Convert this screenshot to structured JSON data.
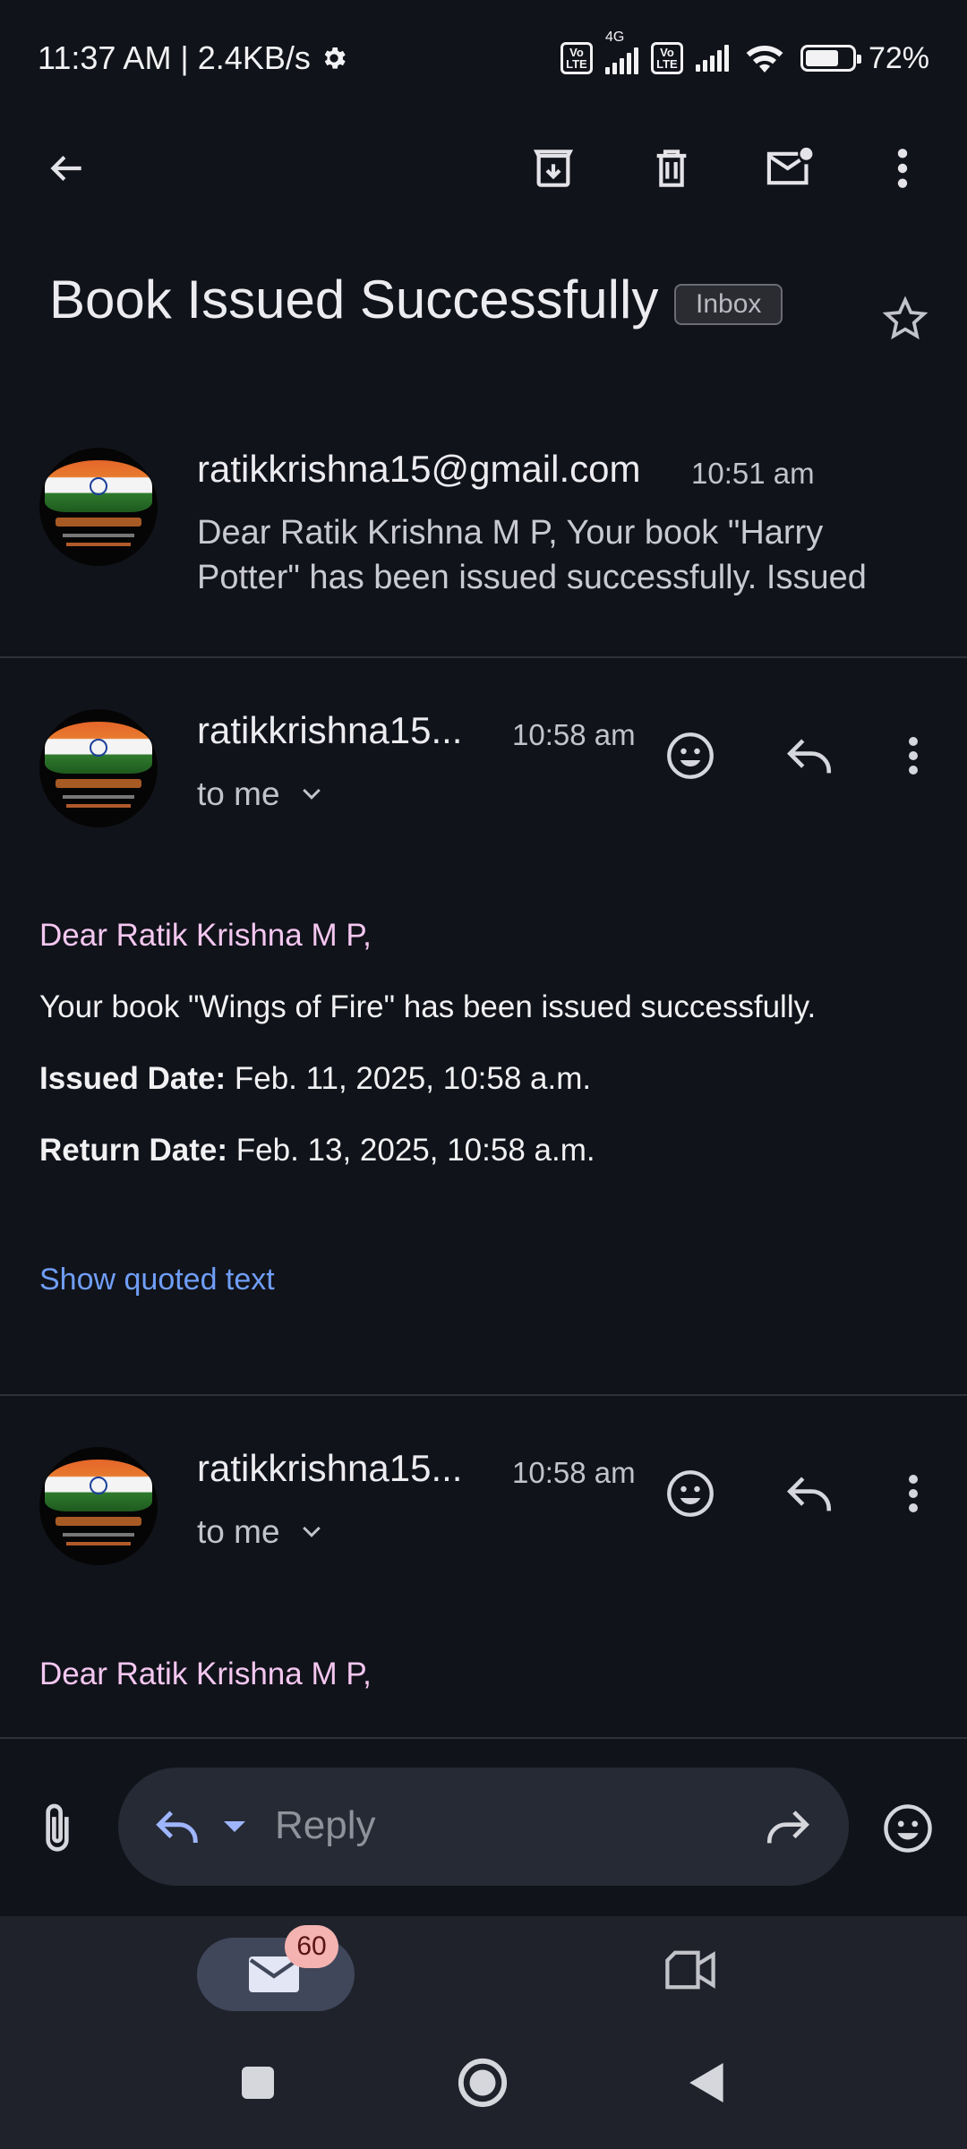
{
  "status_bar": {
    "time": "11:37 AM | 2.4KB/s",
    "network_type": "4G",
    "volte_label": "Vo LTE",
    "battery": "72%",
    "battery_level": 0.72
  },
  "toolbar": {
    "back_icon": "arrow-back-icon",
    "archive_icon": "archive-icon",
    "delete_icon": "trash-icon",
    "mark_unread_icon": "mark-unread-icon",
    "more_icon": "more-vert-icon"
  },
  "thread": {
    "subject": "Book Issued Successfully",
    "label": "Inbox"
  },
  "messages": [
    {
      "sender": "ratikkrishna15@gmail.com",
      "time": "10:51 am",
      "snippet": "Dear Ratik Krishna M P, Your book \"Harry Potter\" has been issued successfully. Issued"
    },
    {
      "sender": "ratikkrishna15...",
      "time": "10:58 am",
      "recipient": "to me",
      "greeting": "Dear Ratik Krishna M P,",
      "body": "Your book \"Wings of Fire\" has been issued successfully.",
      "issued_label": "Issued Date:",
      "issued_value": " Feb. 11, 2025, 10:58 a.m.",
      "return_label": "Return Date:",
      "return_value": " Feb. 13, 2025, 10:58 a.m.",
      "quoted_link": "Show quoted text"
    },
    {
      "sender": "ratikkrishna15...",
      "time": "10:58 am",
      "recipient": "to me",
      "greeting": "Dear Ratik Krishna M P,"
    }
  ],
  "reply_bar": {
    "placeholder": "Reply"
  },
  "bottom_nav": {
    "mail_badge": "60"
  },
  "colors": {
    "background": "#11131a",
    "greeting_text": "#f4c7f0",
    "link": "#6f9ef8",
    "badge": "#f4b2b0"
  }
}
